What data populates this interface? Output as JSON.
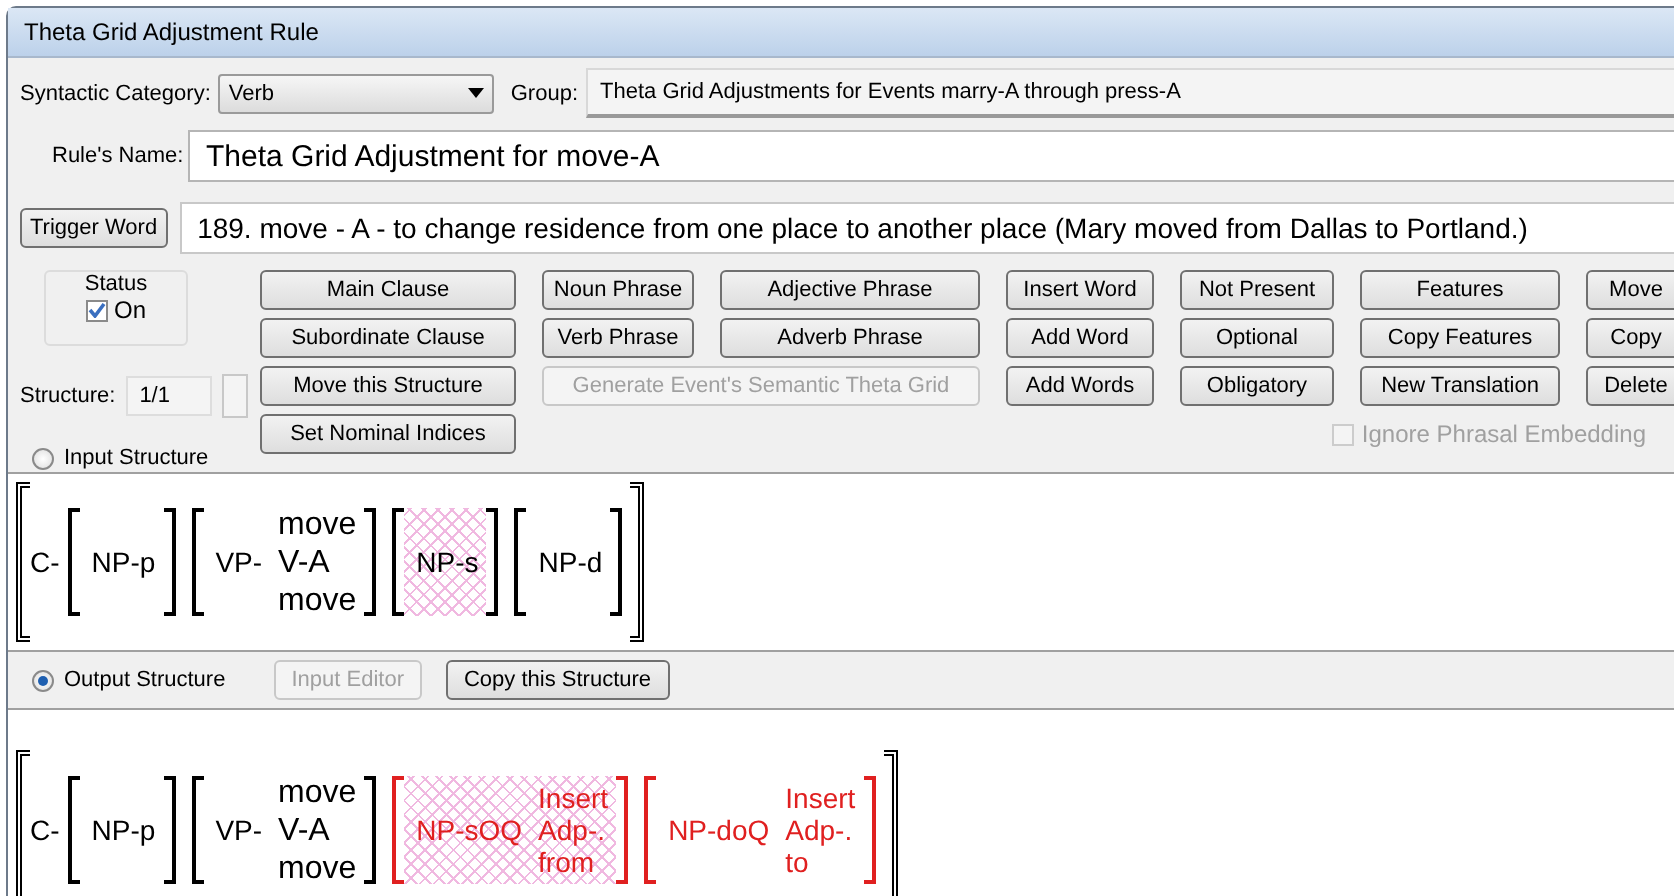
{
  "window": {
    "title": "Theta Grid Adjustment Rule"
  },
  "syntactic_category": {
    "label": "Syntactic Category:",
    "value": "Verb"
  },
  "group": {
    "label": "Group:",
    "value": "Theta Grid Adjustments for Events marry-A through press-A"
  },
  "rule_name": {
    "label": "Rule's Name:",
    "value": "Theta Grid Adjustment for move-A"
  },
  "trigger_word": {
    "button": "Trigger Word",
    "value": "189. move - A - to change residence from one place to another place (Mary moved from Dallas to Portland.)"
  },
  "status": {
    "title": "Status",
    "label": "On",
    "checked": true
  },
  "structure": {
    "label": "Structure:",
    "value": "1/1"
  },
  "button_rows": [
    [
      {
        "label": "Main Clause",
        "kind": "normal",
        "disabled": false
      },
      {
        "label": "Noun Phrase",
        "kind": "normal",
        "disabled": false
      },
      {
        "label": "Adjective Phrase",
        "kind": "normal",
        "disabled": false
      },
      {
        "label": "Insert Word",
        "kind": "normal",
        "disabled": false
      },
      {
        "label": "Not Present",
        "kind": "normal",
        "disabled": false
      },
      {
        "label": "Features",
        "kind": "normal",
        "disabled": false
      },
      {
        "label": "Move",
        "kind": "normal",
        "disabled": false
      }
    ],
    [
      {
        "label": "Subordinate Clause",
        "kind": "normal",
        "disabled": false
      },
      {
        "label": "Verb Phrase",
        "kind": "normal",
        "disabled": false
      },
      {
        "label": "Adverb Phrase",
        "kind": "normal",
        "disabled": false
      },
      {
        "label": "Add Word",
        "kind": "normal",
        "disabled": false
      },
      {
        "label": "Optional",
        "kind": "normal",
        "disabled": false
      },
      {
        "label": "Copy Features",
        "kind": "normal",
        "disabled": false
      },
      {
        "label": "Copy",
        "kind": "normal",
        "disabled": false
      }
    ],
    [
      {
        "label": "Move this Structure",
        "kind": "normal",
        "disabled": false
      },
      {
        "label": "Generate Event's Semantic Theta Grid",
        "kind": "wide",
        "disabled": true
      },
      {
        "label": "Add Words",
        "kind": "normal",
        "disabled": false
      },
      {
        "label": "Obligatory",
        "kind": "normal",
        "disabled": false
      },
      {
        "label": "New Translation",
        "kind": "normal",
        "disabled": false
      },
      {
        "label": "Delete",
        "kind": "normal",
        "disabled": false
      }
    ],
    [
      {
        "label": "Set Nominal Indices",
        "kind": "normal",
        "disabled": false
      }
    ]
  ],
  "ignore_phrasal_embedding": {
    "label": "Ignore Phrasal Embedding",
    "checked": false,
    "disabled": true
  },
  "input_structure": {
    "label": "Input Structure",
    "selected": false,
    "clause": {
      "label": "C-",
      "phrases": [
        {
          "label": "NP-p",
          "highlighted": false,
          "changed": false
        },
        {
          "label": "VP-",
          "lines": [
            "move",
            "V-A",
            "move"
          ],
          "highlighted": false,
          "changed": false
        },
        {
          "label": "NP-s",
          "highlighted": true,
          "changed": false
        },
        {
          "label": "NP-d",
          "highlighted": false,
          "changed": false
        }
      ]
    }
  },
  "output_structure": {
    "label": "Output Structure",
    "selected": true,
    "buttons": [
      {
        "label": "Input Editor",
        "disabled": true
      },
      {
        "label": "Copy this Structure",
        "disabled": false
      }
    ],
    "clause": {
      "label": "C-",
      "phrases": [
        {
          "label": "NP-p",
          "highlighted": false,
          "changed": false
        },
        {
          "label": "VP-",
          "lines": [
            "move",
            "V-A",
            "move"
          ],
          "highlighted": false,
          "changed": false
        },
        {
          "label": "NP-sOQ",
          "lines": [
            "Insert",
            "Adp-.",
            "from"
          ],
          "highlighted": true,
          "changed": true
        },
        {
          "label": "NP-doQ",
          "lines": [
            "Insert",
            "Adp-.",
            "to"
          ],
          "highlighted": false,
          "changed": true
        }
      ]
    }
  }
}
